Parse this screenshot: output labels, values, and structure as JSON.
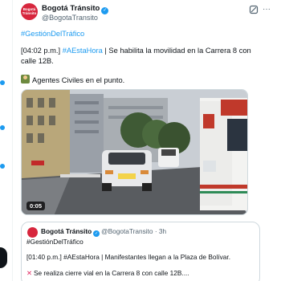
{
  "tweet": {
    "author_name": "Bogotá Tránsito",
    "handle": "@BogotaTransito",
    "avatar_text": "Bogotá Tránsito",
    "hashtag": "#GestiónDelTráfico",
    "time_prefix": "[04:02 p.m.]",
    "body_hashtag": "#AEstaHora",
    "body_text": " | Se habilita la movilidad en la Carrera 8 con calle 12B.",
    "agents_text": "Agentes Civiles en el punto.",
    "video_duration": "0:05"
  },
  "quote": {
    "author_name": "Bogotá Tránsito",
    "handle": "@BogotaTransito",
    "age": "3h",
    "hashtag": "#GestiónDelTráfico",
    "line1_time": "[01:40 p.m.]",
    "line1_hashtag": "#AEstaHora",
    "line1_text": " | Manifestantes llegan a la Plaza de Bolívar.",
    "line2_text": "Se realiza cierre vial en la Carrera 8 con calle 12B...."
  },
  "icons": {
    "verified": "verified-badge-icon",
    "grok": "grok-icon",
    "more": "more-options-icon",
    "agent_emoji": "police-officer-emoji",
    "cross_emoji": "cross-mark-emoji"
  },
  "colors": {
    "accent": "#1d9bf0",
    "brand_red": "#d7263d",
    "muted": "#536471"
  }
}
